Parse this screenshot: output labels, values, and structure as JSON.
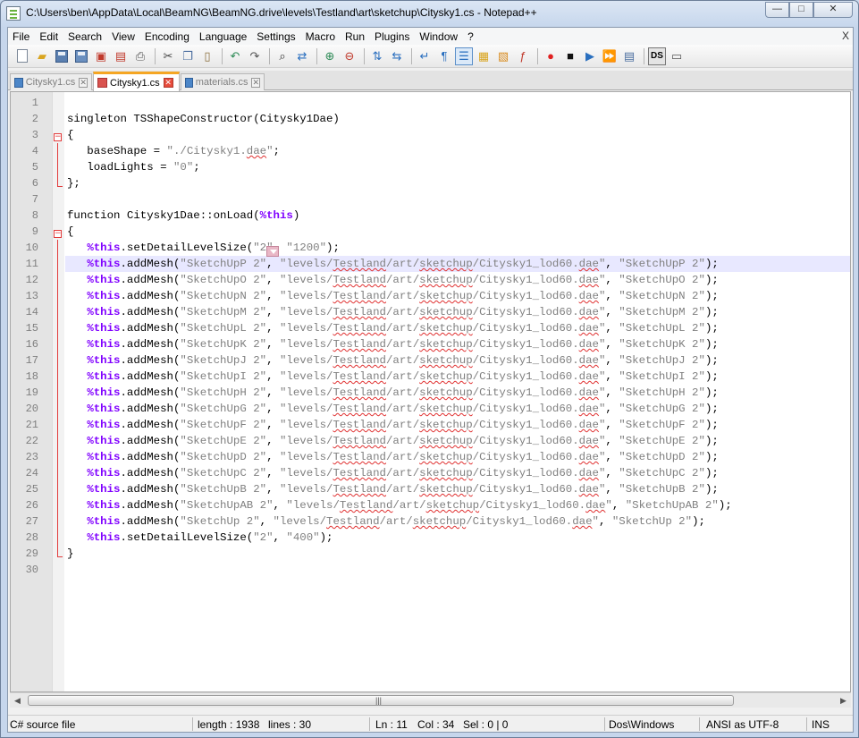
{
  "window": {
    "title": "C:\\Users\\ben\\AppData\\Local\\BeamNG\\BeamNG.drive\\levels\\Testland\\art\\sketchup\\Citysky1.cs - Notepad++",
    "min": "—",
    "max": "□",
    "close": "✕"
  },
  "menu": [
    "File",
    "Edit",
    "Search",
    "View",
    "Encoding",
    "Language",
    "Settings",
    "Macro",
    "Run",
    "Plugins",
    "Window",
    "?"
  ],
  "menu_close": "X",
  "toolbar": {
    "icons": [
      "new-file-icon",
      "open-file-icon",
      "save-icon",
      "save-all-icon",
      "close-file-icon",
      "close-all-icon",
      "print-icon",
      "cut-icon",
      "copy-icon",
      "paste-icon",
      "undo-icon",
      "redo-icon",
      "find-icon",
      "replace-icon",
      "zoom-in-icon",
      "zoom-out-icon",
      "sync-vertical-icon",
      "sync-horizontal-icon",
      "word-wrap-icon",
      "show-all-chars-icon",
      "indent-guide-icon",
      "user-language-icon",
      "doc-map-icon",
      "function-list-icon",
      "record-macro-icon",
      "stop-macro-icon",
      "play-macro-icon",
      "run-macro-multiple-icon",
      "save-macro-icon",
      "ds-plugin-icon",
      "spell-check-icon"
    ],
    "ds_label": "DS"
  },
  "tabs": [
    {
      "label": "Citysky1.cs",
      "active": false,
      "modified": false
    },
    {
      "label": "Citysky1.cs",
      "active": true,
      "modified": true
    },
    {
      "label": "materials.cs",
      "active": false,
      "modified": false
    }
  ],
  "tab_close_glyph": "✕",
  "editor": {
    "current_line": 11,
    "lines": [
      "",
      "singleton TSShapeConstructor(Citysky1Dae)",
      "{",
      "   baseShape = \"./Citysky1.dae\";",
      "   loadLights = \"0\";",
      "};",
      "",
      "function Citysky1Dae::onLoad(%this)",
      "{",
      "   %this.setDetailLevelSize(\"2\", \"1200\");",
      "   %this.addMesh(\"SketchUpP 2\", \"levels/Testland/art/sketchup/Citysky1_lod60.dae\", \"SketchUpP 2\");",
      "   %this.addMesh(\"SketchUpO 2\", \"levels/Testland/art/sketchup/Citysky1_lod60.dae\", \"SketchUpO 2\");",
      "   %this.addMesh(\"SketchUpN 2\", \"levels/Testland/art/sketchup/Citysky1_lod60.dae\", \"SketchUpN 2\");",
      "   %this.addMesh(\"SketchUpM 2\", \"levels/Testland/art/sketchup/Citysky1_lod60.dae\", \"SketchUpM 2\");",
      "   %this.addMesh(\"SketchUpL 2\", \"levels/Testland/art/sketchup/Citysky1_lod60.dae\", \"SketchUpL 2\");",
      "   %this.addMesh(\"SketchUpK 2\", \"levels/Testland/art/sketchup/Citysky1_lod60.dae\", \"SketchUpK 2\");",
      "   %this.addMesh(\"SketchUpJ 2\", \"levels/Testland/art/sketchup/Citysky1_lod60.dae\", \"SketchUpJ 2\");",
      "   %this.addMesh(\"SketchUpI 2\", \"levels/Testland/art/sketchup/Citysky1_lod60.dae\", \"SketchUpI 2\");",
      "   %this.addMesh(\"SketchUpH 2\", \"levels/Testland/art/sketchup/Citysky1_lod60.dae\", \"SketchUpH 2\");",
      "   %this.addMesh(\"SketchUpG 2\", \"levels/Testland/art/sketchup/Citysky1_lod60.dae\", \"SketchUpG 2\");",
      "   %this.addMesh(\"SketchUpF 2\", \"levels/Testland/art/sketchup/Citysky1_lod60.dae\", \"SketchUpF 2\");",
      "   %this.addMesh(\"SketchUpE 2\", \"levels/Testland/art/sketchup/Citysky1_lod60.dae\", \"SketchUpE 2\");",
      "   %this.addMesh(\"SketchUpD 2\", \"levels/Testland/art/sketchup/Citysky1_lod60.dae\", \"SketchUpD 2\");",
      "   %this.addMesh(\"SketchUpC 2\", \"levels/Testland/art/sketchup/Citysky1_lod60.dae\", \"SketchUpC 2\");",
      "   %this.addMesh(\"SketchUpB 2\", \"levels/Testland/art/sketchup/Citysky1_lod60.dae\", \"SketchUpB 2\");",
      "   %this.addMesh(\"SketchUpAB 2\", \"levels/Testland/art/sketchup/Citysky1_lod60.dae\", \"SketchUpAB 2\");",
      "   %this.addMesh(\"SketchUp 2\", \"levels/Testland/art/sketchup/Citysky1_lod60.dae\", \"SketchUp 2\");",
      "   %this.setDetailLevelSize(\"2\", \"400\");",
      "}",
      ""
    ],
    "fold_open_glyph": "−"
  },
  "scrollbar": {
    "left": "◀",
    "right": "▶",
    "grip": "|||"
  },
  "status": {
    "file_type": "C# source file",
    "length": "length : 1938",
    "lines": "lines : 30",
    "ln": "Ln : 11",
    "col": "Col : 34",
    "sel": "Sel : 0 | 0",
    "eol": "Dos\\Windows",
    "encoding": "ANSI as UTF-8",
    "mode": "INS"
  },
  "colors": {
    "keyword_this": "#8000ff",
    "string": "#808080",
    "fold": "#e23b3b",
    "current_line": "#e8e8ff",
    "active_tab_accent": "#f5a623"
  }
}
